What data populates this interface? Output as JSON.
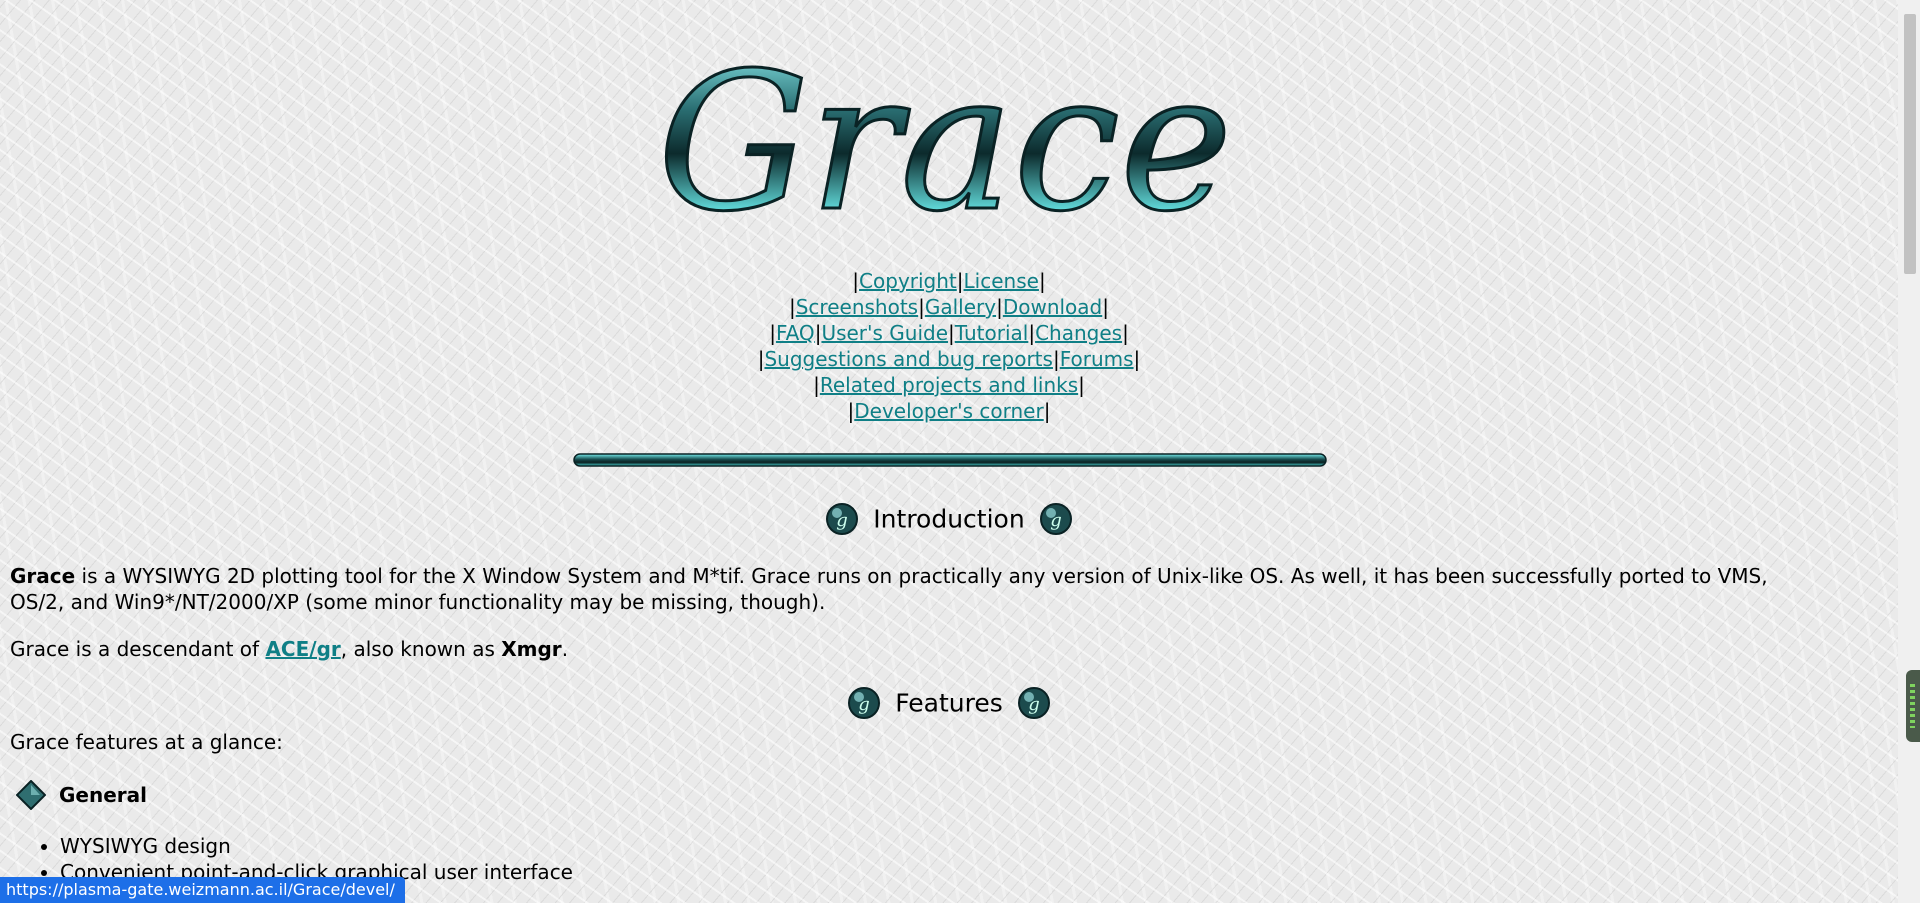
{
  "logo_text": "Grace",
  "nav": {
    "rows": [
      [
        "Copyright",
        "License"
      ],
      [
        "Screenshots",
        "Gallery",
        "Download"
      ],
      [
        "FAQ",
        "User's Guide",
        "Tutorial",
        "Changes"
      ],
      [
        "Suggestions and bug reports",
        "Forums"
      ],
      [
        "Related projects and links"
      ],
      [
        "Developer's corner"
      ]
    ],
    "separator": "|"
  },
  "introduction": {
    "title": "Introduction",
    "p1_name": "Grace",
    "p1_text": " is a WYSIWYG 2D plotting tool for the X Window System and M*tif. Grace runs on practically any version of Unix-like OS. As well, it has been successfully ported to VMS, OS/2, and Win9*/NT/2000/XP (some minor functionality may be missing, though).",
    "p2_prefix": "Grace is a descendant of ",
    "p2_link": "ACE/gr",
    "p2_middle": ", also known as ",
    "p2_bold": "Xmgr",
    "p2_suffix": "."
  },
  "features": {
    "title": "Features",
    "intro": "Grace features at a glance:",
    "general_title": "General",
    "items": [
      "WYSIWYG design",
      "Convenient point-and-click graphical user interface"
    ]
  },
  "status_url": "https://plasma-gate.weizmann.ac.il/Grace/devel/",
  "colors": {
    "link": "#0f7f86",
    "status_bg": "#1d6fe8"
  },
  "icons": [
    "grace-logo",
    "ball-icon",
    "diamond-icon"
  ]
}
